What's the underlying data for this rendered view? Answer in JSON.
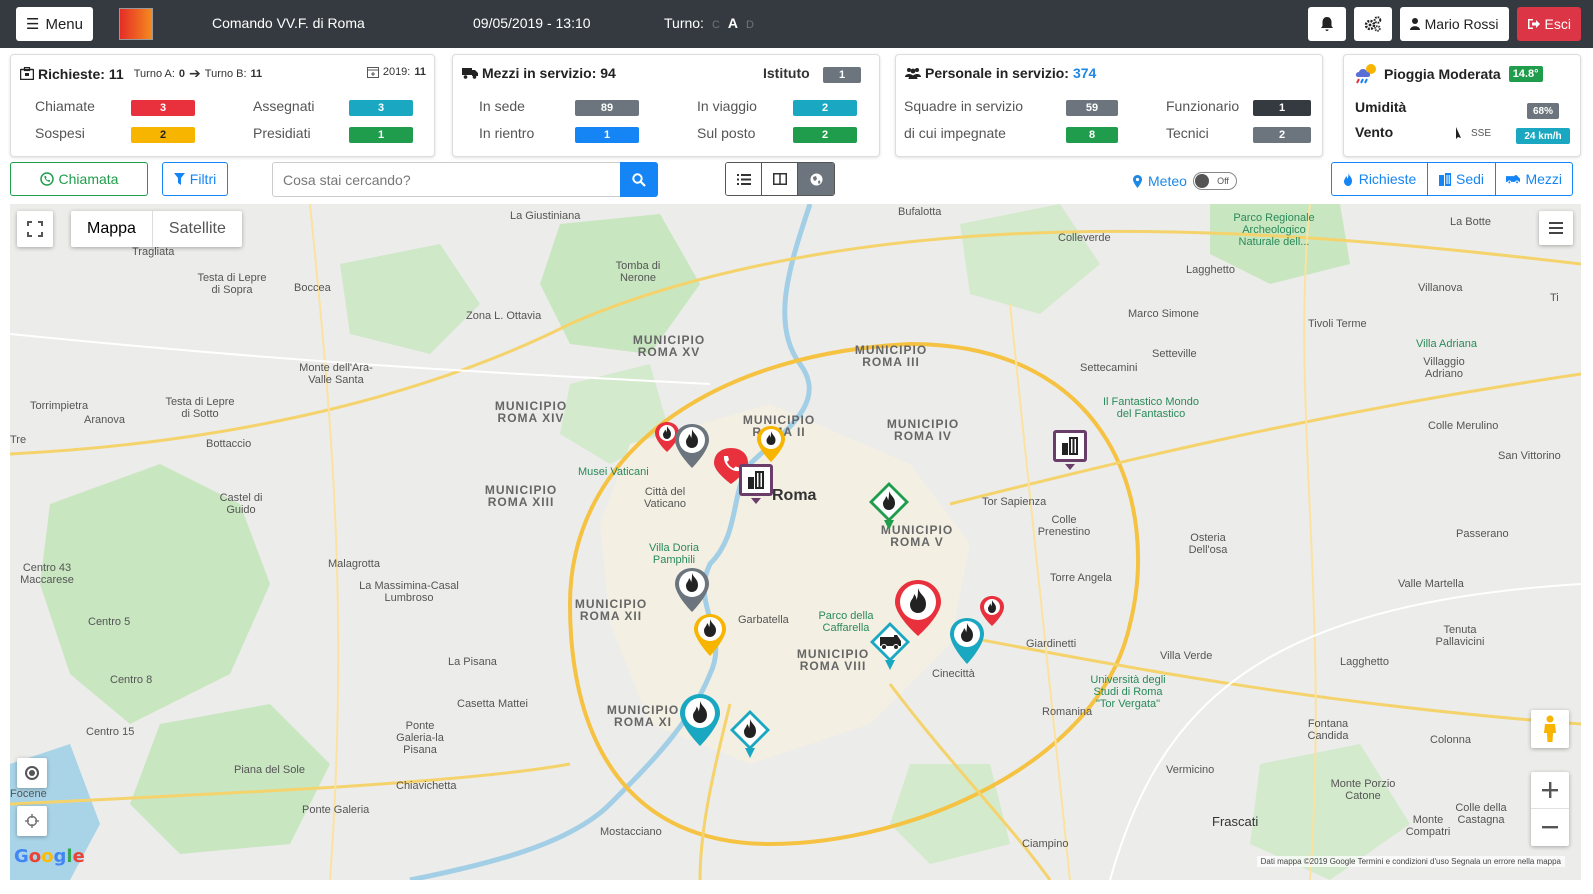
{
  "navbar": {
    "menu_label": "Menu",
    "comando": "Comando VV.F. di Roma",
    "datetime": "09/05/2019 - 13:10",
    "turno_label": "Turno:",
    "turno_c": "C",
    "turno_a": "A",
    "turno_d": "D",
    "user": "Mario Rossi",
    "exit_label": "Esci"
  },
  "richieste": {
    "title": "Richieste:",
    "count": "11",
    "turno_a_label": "Turno A:",
    "turno_a_value": "0",
    "turno_b_label": "Turno B:",
    "turno_b_value": "11",
    "year_label": "2019:",
    "year_value": "11",
    "chiamate_label": "Chiamate",
    "chiamate_value": "3",
    "assegnati_label": "Assegnati",
    "assegnati_value": "3",
    "sospesi_label": "Sospesi",
    "sospesi_value": "2",
    "presidiati_label": "Presidiati",
    "presidiati_value": "1"
  },
  "mezzi": {
    "title": "Mezzi in servizio: 94",
    "istituto_label": "Istituto",
    "istituto_value": "1",
    "insede_label": "In sede",
    "insede_value": "89",
    "inviaggio_label": "In viaggio",
    "inviaggio_value": "2",
    "inrientro_label": "In rientro",
    "inrientro_value": "1",
    "sulposto_label": "Sul posto",
    "sulposto_value": "2"
  },
  "personale": {
    "title": "Personale in servizio:",
    "count": "374",
    "squadre_label": "Squadre in servizio",
    "squadre_value": "59",
    "funzionario_label": "Funzionario",
    "funzionario_value": "1",
    "impegnate_label": "di cui impegnate",
    "impegnate_value": "8",
    "tecnici_label": "Tecnici",
    "tecnici_value": "2"
  },
  "meteo_card": {
    "title": "Pioggia Moderata",
    "temp": "14.8°",
    "umidita_label": "Umidità",
    "umidita_value": "68%",
    "vento_label": "Vento",
    "vento_dir": "SSE",
    "vento_value": "24 km/h"
  },
  "toolbar": {
    "chiamata_label": "Chiamata",
    "filtri_label": "Filtri",
    "search_placeholder": "Cosa stai cercando?",
    "meteo_label": "Meteo",
    "meteo_toggle": "Off",
    "richieste_label": "Richieste",
    "sedi_label": "Sedi",
    "mezzi_label": "Mezzi"
  },
  "map": {
    "type_map": "Mappa",
    "type_satellite": "Satellite",
    "attribution": "Dati mappa ©2019 Google   Termini e condizioni d'uso   Segnala un errore nella mappa",
    "google": "Google",
    "labels": {
      "giustiniana": "La Giustiniana",
      "tragliata": "Tragliata",
      "testa_lepre": "Testa di Lepre di Sopra",
      "boccea": "Boccea",
      "tomba_nerone": "Tomba di Nerone",
      "zona_ottavia": "Zona L. Ottavia",
      "monte_ara": "Monte dell'Ara-Valle Santa",
      "torrimpietra": "Torrimpietra",
      "testa_sotto": "Testa di Lepre di Sotto",
      "aranova": "Aranova",
      "bottaccio": "Bottaccio",
      "castel_guido": "Castel di Guido",
      "malagrotta": "Malagrotta",
      "massimina": "La Massimina-Casal Lumbroso",
      "centro43": "Centro 43 Maccarese",
      "centro5": "Centro 5",
      "centro8": "Centro 8",
      "centro15": "Centro 15",
      "pisana": "La Pisana",
      "casetta_mattei": "Casetta Mattei",
      "ponte_galeria_pisana": "Ponte Galeria-la Pisana",
      "piana_sole": "Piana del Sole",
      "chiavichetta": "Chiavichetta",
      "ponte_galeria": "Ponte Galeria",
      "mostacciano": "Mostacciano",
      "musei": "Musei Vaticani",
      "citta_vaticano": "Città del Vaticano",
      "villa_doria": "Villa Doria Pamphili",
      "garbatella": "Garbatella",
      "roma": "Roma",
      "parco_caffarella": "Parco della Caffarella",
      "cinecitta": "Cinecittà",
      "giardinetti": "Giardinetti",
      "torre_angela": "Torre Angela",
      "romanina": "Romanina",
      "tor_sapienza": "Tor Sapienza",
      "colle_prenestino": "Colle Prenestino",
      "osteria": "Osteria Dell'osa",
      "bufalotta": "Bufalotta",
      "colleverde": "Colleverde",
      "parco_archeo": "Parco Regionale Archeologico Naturale dell...",
      "la_botte": "La Botte",
      "lagghetto_top": "Lagghetto",
      "villanova": "Villanova",
      "marco_simone": "Marco Simone",
      "tivoli_terme": "Tivoli Terme",
      "settecamini": "Settecamini",
      "setteville": "Setteville",
      "villa_adriana": "Villa Adriana",
      "villaggio_adriano": "Villaggio Adriano",
      "fantastico": "Il Fantastico Mondo del Fantastico",
      "colle_merulino": "Colle Merulino",
      "san_vittorino": "San Vittorino",
      "passerano": "Passerano",
      "valle_martella": "Valle Martella",
      "tenuta_pallavicini": "Tenuta Pallavicini",
      "villa_verde": "Villa Verde",
      "lagghetto_bot": "Lagghetto",
      "universita": "Università degli Studi di Roma \"Tor Vergata\"",
      "fontana_candida": "Fontana Candida",
      "colonna": "Colonna",
      "vermicino": "Vermicino",
      "monte_porzio": "Monte Porzio Catone",
      "colle_castagna": "Colle della Castagna",
      "monte_compatri": "Monte Compatri",
      "frascati": "Frascati",
      "ciampino": "Ciampino",
      "focene": "Focene",
      "tre": "Tre",
      "ti": "Ti"
    },
    "municipi": {
      "xv": "MUNICIPIO ROMA XV",
      "xiv": "MUNICIPIO ROMA XIV",
      "xiii": "MUNICIPIO ROMA XIII",
      "xii": "MUNICIPIO ROMA XII",
      "xi": "MUNICIPIO ROMA XI",
      "viii": "MUNICIPIO ROMA VIII",
      "v": "MUNICIPIO ROMA V",
      "iv": "MUNICIPIO ROMA IV",
      "iii": "MUNICIPIO ROMA III",
      "ii": "MUNICIPIO ROMA II"
    },
    "colors": {
      "red": "#e8313d",
      "gray": "#6c757d",
      "yellow": "#f7b500",
      "cyan": "#1aa7c2",
      "green": "#1f9d4c",
      "purple": "#6b3d6b"
    }
  }
}
